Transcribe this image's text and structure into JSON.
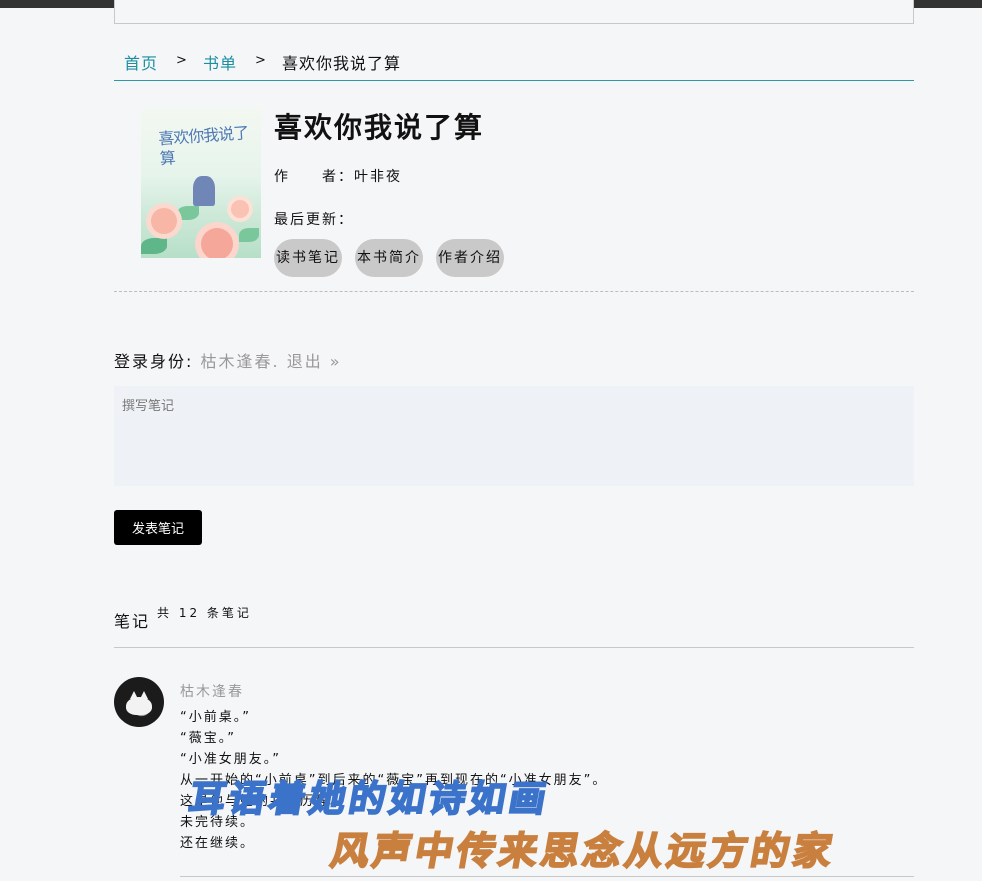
{
  "breadcrumb": {
    "home": "首页",
    "sep1": ">",
    "booklist": "书单",
    "sep2": ">",
    "current": "喜欢你我说了算"
  },
  "book": {
    "cover_title": "喜欢你我说了算",
    "title": "喜欢你我说了算",
    "author_line": "作　　者：叶非夜",
    "updated_line": "最后更新：",
    "buttons": [
      "读书笔记",
      "本书简介",
      "作者介绍"
    ]
  },
  "login": {
    "label": "登录身份:",
    "user": "枯木逢春.",
    "logout": "退出",
    "raquo": "»"
  },
  "note_form": {
    "placeholder": "撰写笔记",
    "submit_label": "发表笔记"
  },
  "notes": {
    "label": "笔记",
    "count_text": "共 12 条笔记",
    "items": [
      {
        "author": "枯木逢春",
        "lines": [
          "  “小前桌。”",
          "  “薇宝。”",
          "  “小准女朋友。”",
          "从一开始的“小前桌”到后来的“薇宝”再到现在的“小准女朋友”。",
          "这是他与她的共同历程。",
          "未完待续。",
          "还在继续。"
        ]
      }
    ]
  },
  "overlay_lyrics": {
    "line1": "耳语着她的如诗如画",
    "line2": "风声中传来思念从远方的家"
  },
  "colors": {
    "accent": "#1a8fa0",
    "muted": "#999999",
    "pill_bg": "#c9c9c9",
    "button_bg": "#000000"
  }
}
